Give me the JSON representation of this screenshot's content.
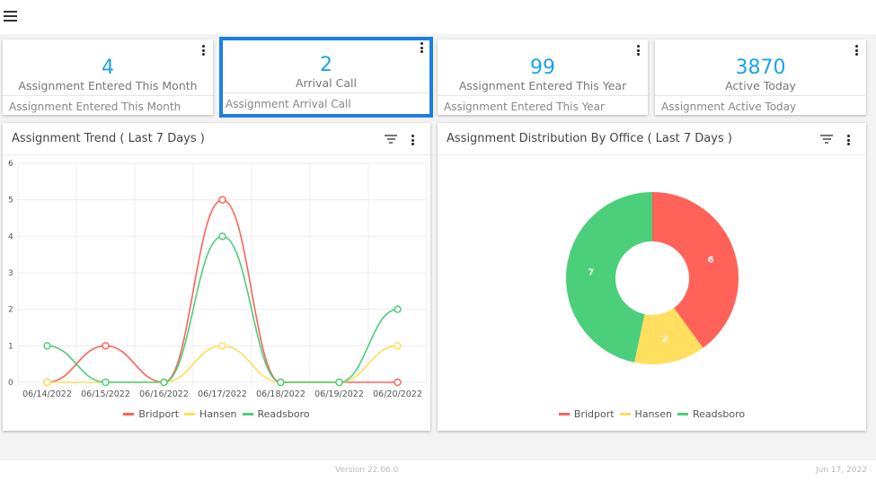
{
  "topbar": {
    "menu_icon": "hamburger-menu-icon"
  },
  "kpis": [
    {
      "value": "4",
      "label": "Assignment Entered This Month",
      "footer": "Assignment Entered This Month",
      "selected": false
    },
    {
      "value": "2",
      "label": "Arrival Call",
      "footer": "Assignment Arrival Call",
      "selected": true
    },
    {
      "value": "99",
      "label": "Assignment Entered This Year",
      "footer": "Assignment Entered This Year",
      "selected": false
    },
    {
      "value": "3870",
      "label": "Active Today",
      "footer": "Assignment Active Today",
      "selected": false
    }
  ],
  "panels": {
    "trend": {
      "title": "Assignment Trend ( Last 7 Days )"
    },
    "distribution": {
      "title": "Assignment Distribution By Office ( Last 7 Days )"
    }
  },
  "colors": {
    "Bridport": "#ff6259",
    "Hansen": "#ffdf5d",
    "Readsboro": "#4ccf7a",
    "accent": "#1aa3e8",
    "selected_border": "#1a7fe8"
  },
  "chart_data": [
    {
      "type": "line",
      "title": "Assignment Trend ( Last 7 Days )",
      "xlabel": "",
      "ylabel": "",
      "categories": [
        "06/14/2022",
        "06/15/2022",
        "06/16/2022",
        "06/17/2022",
        "06/18/2022",
        "06/19/2022",
        "06/20/2022"
      ],
      "series": [
        {
          "name": "Bridport",
          "values": [
            0,
            1,
            0,
            5,
            0,
            0,
            0
          ]
        },
        {
          "name": "Hansen",
          "values": [
            0,
            0,
            0,
            1,
            0,
            0,
            1
          ]
        },
        {
          "name": "Readsboro",
          "values": [
            1,
            0,
            0,
            4,
            0,
            0,
            2
          ]
        }
      ],
      "ylim": [
        0,
        6
      ],
      "yticks": [
        "0",
        "1",
        "2",
        "3",
        "4",
        "5",
        "6"
      ],
      "grid": true,
      "smooth": true,
      "legend": "bottom-center"
    },
    {
      "type": "pie",
      "donut": true,
      "title": "Assignment Distribution By Office ( Last 7 Days )",
      "labels": [
        "Bridport",
        "Hansen",
        "Readsboro"
      ],
      "values": [
        6,
        2,
        7
      ],
      "legend": "bottom-center"
    }
  ],
  "legend_labels": [
    "Bridport",
    "Hansen",
    "Readsboro"
  ],
  "footer": {
    "version": "Version 22.06.0",
    "date": "Jun 17, 2022"
  }
}
